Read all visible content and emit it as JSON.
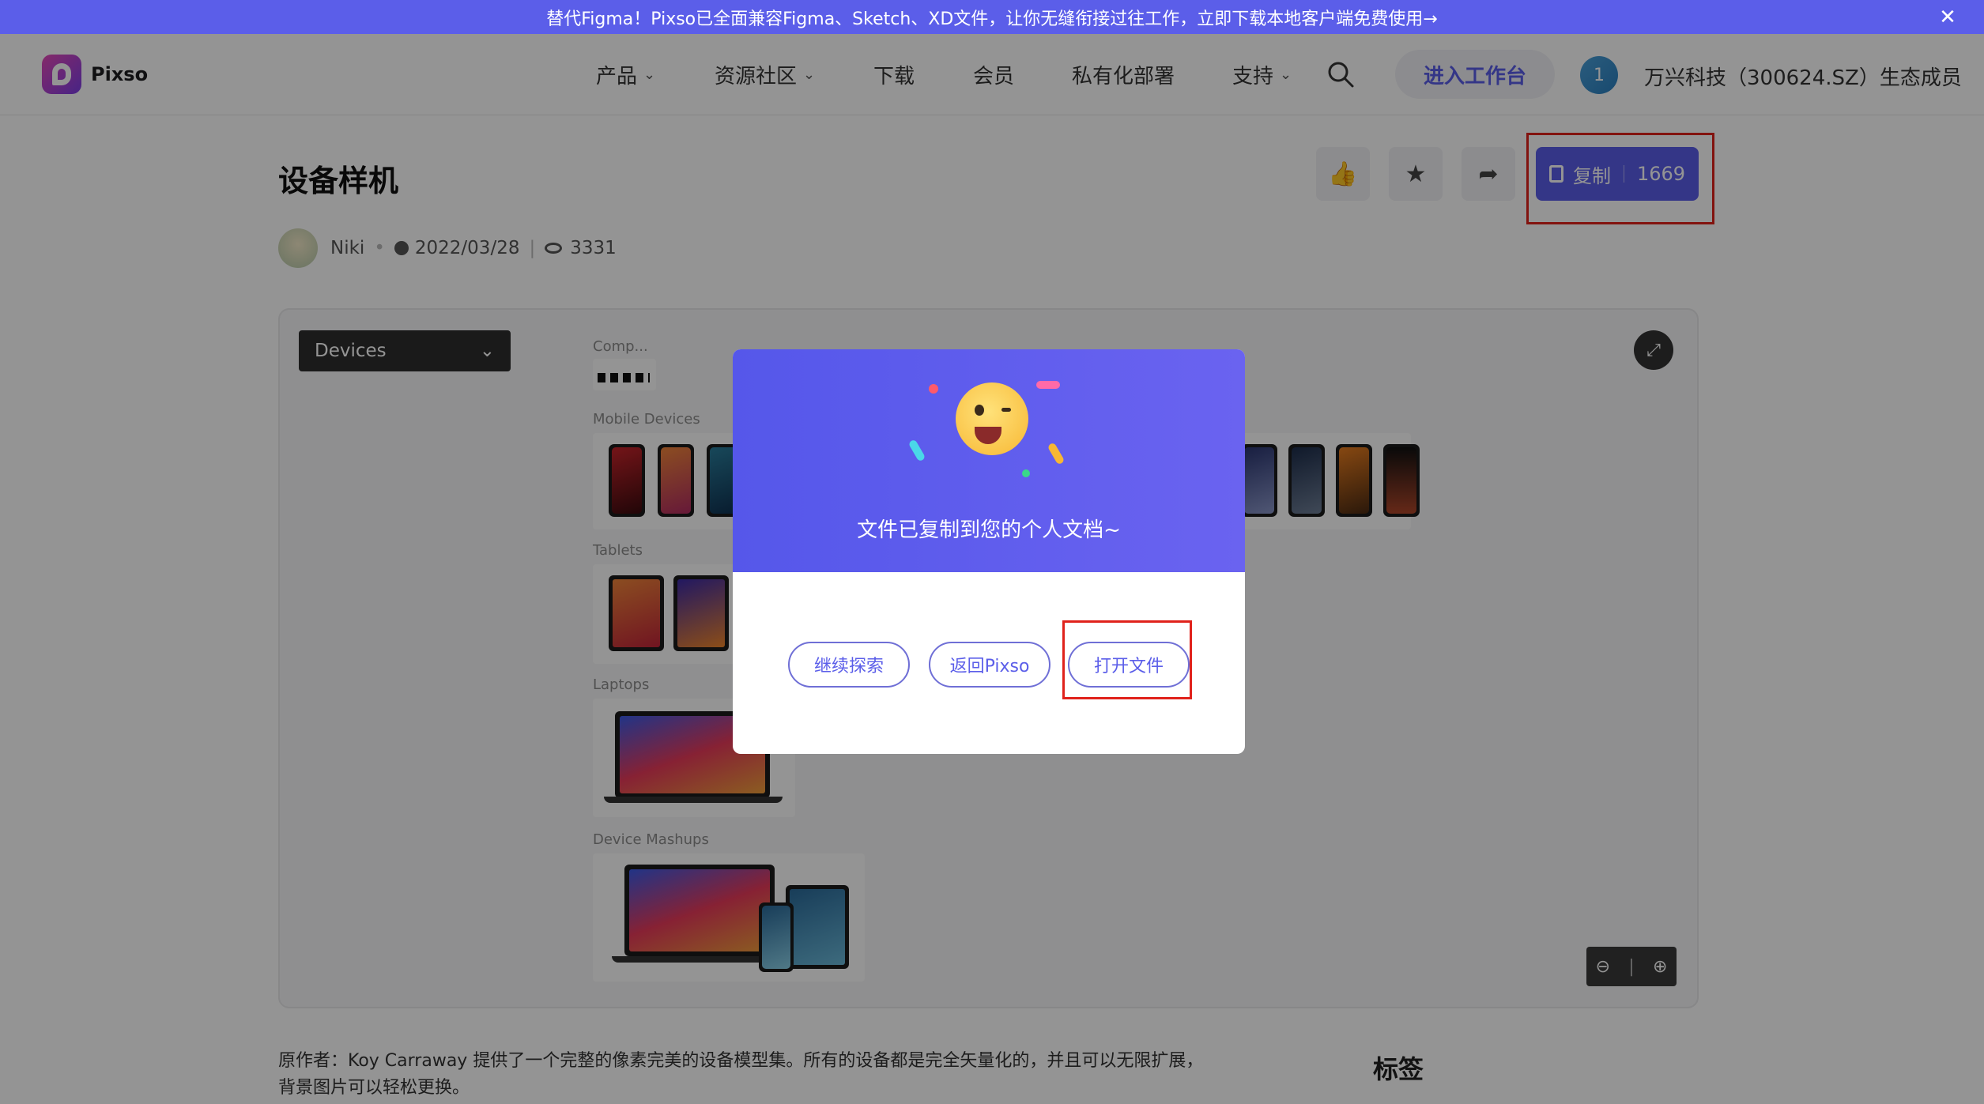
{
  "banner": {
    "text": "替代Figma！Pixso已全面兼容Figma、Sketch、XD文件，让你无缝衔接过往工作，立即下载本地客户端免费使用→",
    "close_icon": "close-icon"
  },
  "header": {
    "logo_text": "Pixso",
    "nav": [
      {
        "label": "产品",
        "has_dropdown": true
      },
      {
        "label": "资源社区",
        "has_dropdown": true
      },
      {
        "label": "下载",
        "has_dropdown": false
      },
      {
        "label": "会员",
        "has_dropdown": false
      },
      {
        "label": "私有化部署",
        "has_dropdown": false
      },
      {
        "label": "支持",
        "has_dropdown": true
      }
    ],
    "workbench_label": "进入工作台",
    "avatar_number": "1",
    "org_text": "万兴科技（300624.SZ）生态成员"
  },
  "resource": {
    "title": "设备样机",
    "author": "Niki",
    "date": "2022/03/28",
    "views": "3331",
    "copy_label": "复制",
    "copy_count": "1669",
    "actions": [
      "like-icon",
      "star-icon",
      "share-icon"
    ]
  },
  "preview": {
    "select_value": "Devices",
    "sections": {
      "components": "Comp...",
      "mobile": "Mobile Devices",
      "tablets": "Tablets",
      "laptops": "Laptops",
      "mashups": "Device Mashups"
    },
    "zoom_out_icon": "zoom-out-icon",
    "zoom_in_icon": "zoom-in-icon",
    "expand_icon": "expand-icon"
  },
  "description": {
    "line1": "原作者：Koy Carraway 提供了一个完整的像素完美的设备模型集。所有的设备都是完全矢量化的，并且可以无限扩展，",
    "line2": "背景图片可以轻松更换。",
    "tags_title": "标签"
  },
  "modal": {
    "message": "文件已复制到您的个人文档~",
    "buttons": [
      "继续探索",
      "返回Pixso",
      "打开文件"
    ]
  },
  "colors": {
    "accent": "#5b5ee9",
    "highlight": "#e0221b"
  }
}
